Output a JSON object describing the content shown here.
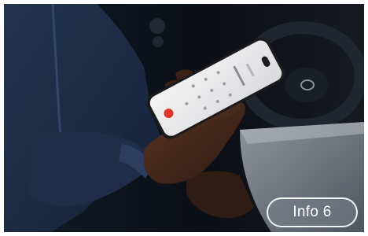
{
  "photo": {
    "subject": "person-holding-smartphone-in-car"
  },
  "badge": {
    "label": "Info 6"
  },
  "colors": {
    "sweater": "#1c2a44",
    "skin": "#4a2a1c",
    "phone_screen": "#e9e9ea",
    "call_button": "#e5322b",
    "badge_border": "#ffffff"
  }
}
